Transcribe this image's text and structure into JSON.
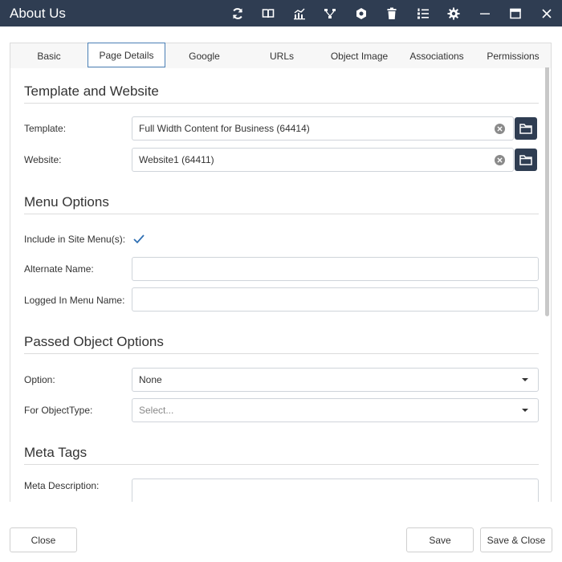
{
  "window": {
    "title": "About Us",
    "toolbar_icons": [
      "refresh-icon",
      "book-icon",
      "chart-icon",
      "workflow-icon",
      "settings-gear-icon",
      "trash-icon",
      "list-icon",
      "gear-icon",
      "minimize-icon",
      "maximize-icon",
      "close-icon"
    ]
  },
  "tabs": [
    {
      "label": "Basic",
      "active": false
    },
    {
      "label": "Page Details",
      "active": true
    },
    {
      "label": "Google",
      "active": false
    },
    {
      "label": "URLs",
      "active": false
    },
    {
      "label": "Object Image",
      "active": false
    },
    {
      "label": "Associations",
      "active": false
    },
    {
      "label": "Permissions",
      "active": false
    }
  ],
  "sections": {
    "template_website": {
      "title": "Template and Website",
      "template_label": "Template:",
      "template_value": "Full Width Content for Business (64414)",
      "website_label": "Website:",
      "website_value": "Website1 (64411)"
    },
    "menu_options": {
      "title": "Menu Options",
      "include_label": "Include in Site Menu(s):",
      "include_checked": true,
      "alternate_label": "Alternate Name:",
      "alternate_value": "",
      "logged_in_label": "Logged In Menu Name:",
      "logged_in_value": ""
    },
    "passed_object": {
      "title": "Passed Object Options",
      "option_label": "Option:",
      "option_value": "None",
      "object_type_label": "For ObjectType:",
      "object_type_placeholder": "Select..."
    },
    "meta_tags": {
      "title": "Meta Tags",
      "description_label": "Meta Description:",
      "description_value": ""
    }
  },
  "footer": {
    "close_label": "Close",
    "save_label": "Save",
    "save_close_label": "Save & Close"
  },
  "colors": {
    "titlebar": "#2f3d52",
    "accent": "#4a7fb5",
    "checkmark": "#2f6fb3"
  }
}
